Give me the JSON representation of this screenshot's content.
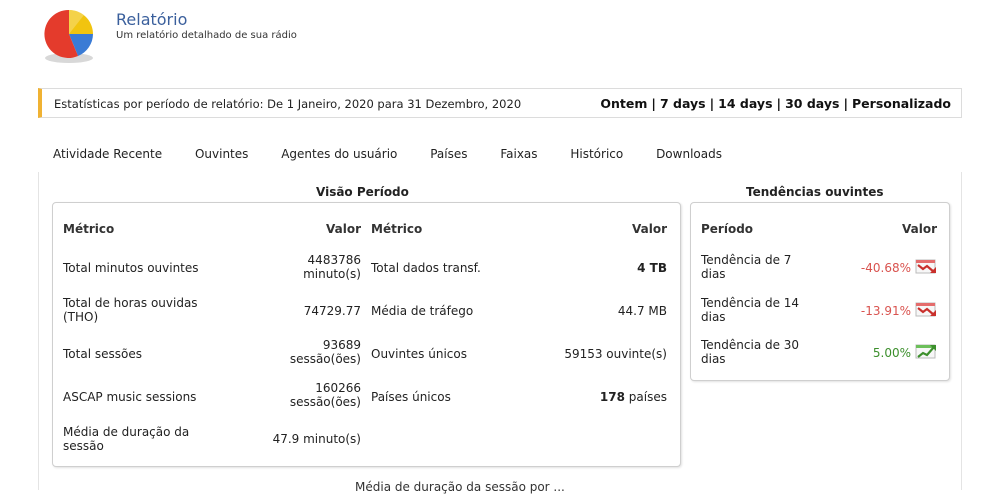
{
  "header": {
    "title": "Relatório",
    "subtitle": "Um relatório detalhado de sua rádio"
  },
  "period": {
    "text": "Estatísticas por período de relatório: De 1 Janeiro, 2020 para 31 Dezembro, 2020",
    "links": [
      "Ontem",
      "7 days",
      "14 days",
      "30 days",
      "Personalizado"
    ],
    "separator": "|"
  },
  "tabs": [
    "Atividade Recente",
    "Ouvintes",
    "Agentes do usuário",
    "Países",
    "Faixas",
    "Histórico",
    "Downloads"
  ],
  "overview": {
    "title": "Visão Período",
    "col_metric": "Métrico",
    "col_value": "Valor",
    "left_rows": [
      {
        "metric": "Total minutos ouvintes",
        "value_line1": "4483786",
        "value_line2": "minuto(s)"
      },
      {
        "metric_line1": "Total de horas ouvidas",
        "metric_line2": "(THO)",
        "value": "74729.77"
      },
      {
        "metric": "Total sessões",
        "value_line1": "93689",
        "value_line2": "sessão(ões)"
      },
      {
        "metric": "ASCAP music sessions",
        "value_line1": "160266",
        "value_line2": "sessão(ões)"
      },
      {
        "metric_line1": "Média de duração da",
        "metric_line2": "sessão",
        "value": "47.9 minuto(s)"
      }
    ],
    "right_rows": [
      {
        "metric": "Total dados transf.",
        "value": "4 TB"
      },
      {
        "metric": "Média de tráfego",
        "value": "44.7 MB"
      },
      {
        "metric": "Ouvintes únicos",
        "value": "59153 ouvinte(s)"
      },
      {
        "metric": "Países únicos",
        "value_bold": "178",
        "value_rest": " países"
      }
    ]
  },
  "trends": {
    "title": "Tendências ouvintes",
    "col_period": "Período",
    "col_value": "Valor",
    "rows": [
      {
        "label_line1": "Tendência de 7",
        "label_line2": "dias",
        "value": "-40.68%",
        "icon": "trend-down-icon",
        "color": "#d9534f"
      },
      {
        "label_line1": "Tendência de 14",
        "label_line2": "dias",
        "value": "-13.91%",
        "icon": "trend-down-icon",
        "color": "#d9534f"
      },
      {
        "label_line1": "Tendência de 30",
        "label_line2": "dias",
        "value": "5.00%",
        "icon": "trend-up-icon",
        "color": "#3c8f2c"
      }
    ]
  },
  "footer_cut_text": "Média de duração da sessão por ..."
}
